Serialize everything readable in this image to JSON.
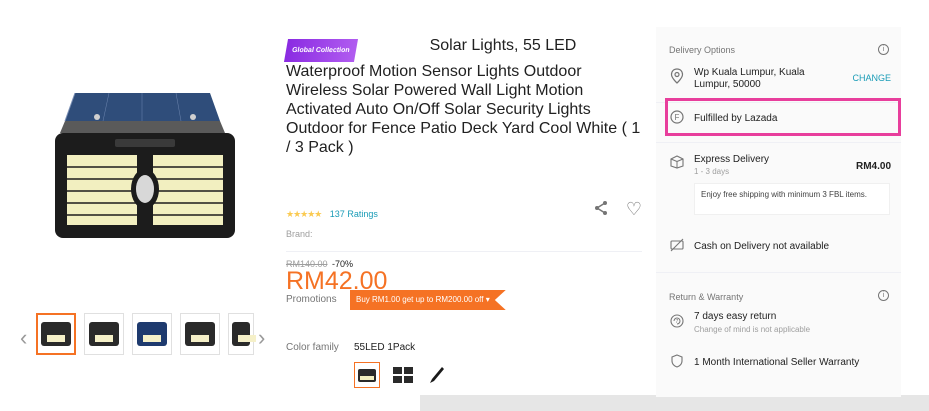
{
  "product": {
    "badge": "Global Collection",
    "title_first_line": "Solar Lights, 55 LED",
    "title_rest": "Waterproof Motion Sensor Lights Outdoor Wireless Solar Powered Wall Light Motion Activated Auto On/Off Solar Security Lights Outdoor for Fence Patio Deck Yard Cool White ( 1 / 3 Pack )",
    "stars": "★★★★★",
    "ratings": "137 Ratings",
    "brand_label": "Brand:",
    "price": "RM42.00",
    "old_price": "RM140.00",
    "discount": "-70%",
    "promotions_label": "Promotions",
    "promotion_tag": "Buy RM1.00 get up to RM200.00 off",
    "color_family_label": "Color family",
    "color_family_value": "55LED 1Pack"
  },
  "delivery": {
    "section_title": "Delivery Options",
    "location": "Wp Kuala Lumpur, Kuala Lumpur, 50000",
    "change": "CHANGE",
    "fulfilled": "Fulfilled by Lazada",
    "express": "Express Delivery",
    "express_days": "1 - 3 days",
    "express_price": "RM4.00",
    "free_shipping_note": "Enjoy free shipping with minimum 3 FBL items.",
    "cod": "Cash on Delivery not available"
  },
  "returns": {
    "section_title": "Return & Warranty",
    "easy_return": "7 days easy return",
    "easy_return_sub": "Change of mind is not applicable",
    "warranty": "1 Month International Seller Warranty"
  },
  "colors": {
    "accent": "#f57224",
    "link": "#1a9cb7",
    "highlight": "#e83e9c",
    "badge": "#8a2be2"
  }
}
